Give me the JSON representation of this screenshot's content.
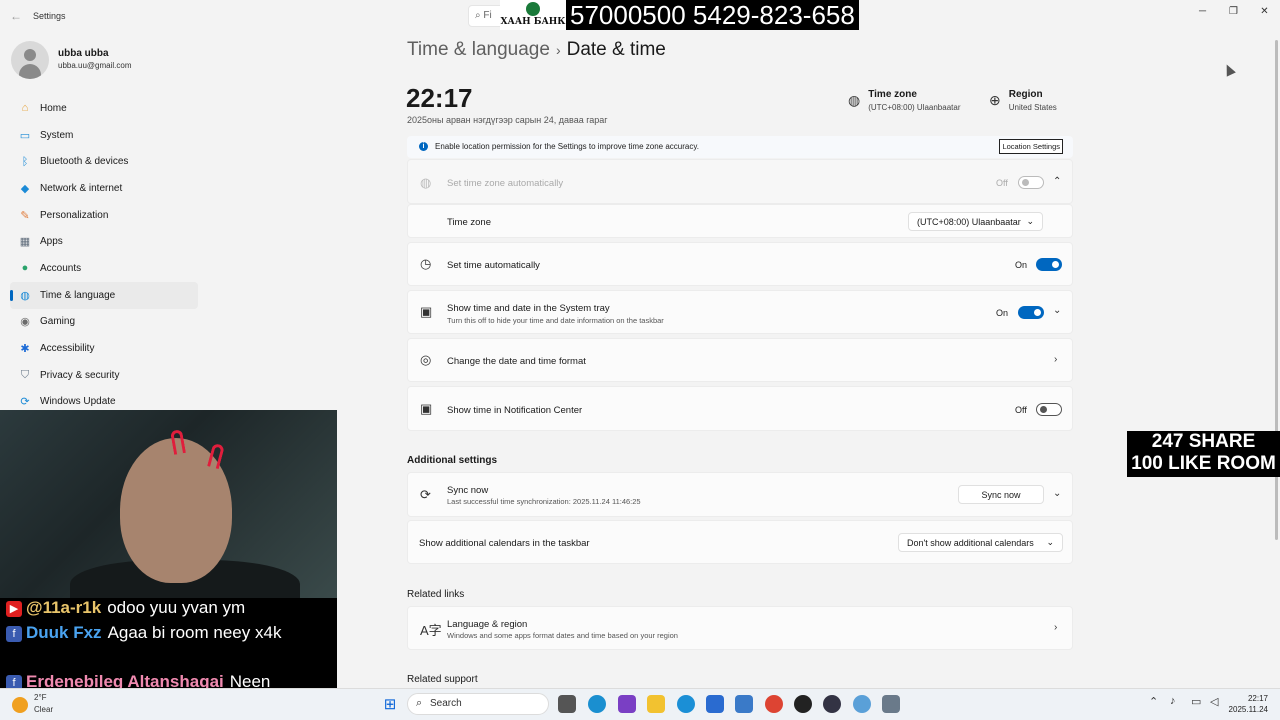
{
  "window": {
    "app_title": "Settings",
    "search_placeholder": "Fi"
  },
  "overlay": {
    "bank_name": "ХААН БАНК",
    "bank_number": "57000500 5429-823-658",
    "promo_line1": "247 SHARE",
    "promo_line2": "100 LIKE ROOM"
  },
  "profile": {
    "name": "ubba ubba",
    "email": "ubba.uu@gmail.com"
  },
  "sidebar": {
    "items": [
      {
        "label": "Home",
        "icon": "home-icon",
        "color": "#e5a33b"
      },
      {
        "label": "System",
        "icon": "monitor-icon",
        "color": "#1b8ad6"
      },
      {
        "label": "Bluetooth & devices",
        "icon": "bluetooth-icon",
        "color": "#1b8ad6"
      },
      {
        "label": "Network & internet",
        "icon": "wifi-icon",
        "color": "#1b8ad6"
      },
      {
        "label": "Personalization",
        "icon": "brush-icon",
        "color": "#e07b3a"
      },
      {
        "label": "Apps",
        "icon": "apps-icon",
        "color": "#5e6b7a"
      },
      {
        "label": "Accounts",
        "icon": "person-icon",
        "color": "#2aa36b"
      },
      {
        "label": "Time & language",
        "icon": "globe-clock-icon",
        "color": "#1b8ad6"
      },
      {
        "label": "Gaming",
        "icon": "controller-icon",
        "color": "#6b6b6b"
      },
      {
        "label": "Accessibility",
        "icon": "accessibility-icon",
        "color": "#1b6ad6"
      },
      {
        "label": "Privacy & security",
        "icon": "shield-icon",
        "color": "#6b7a8a"
      },
      {
        "label": "Windows Update",
        "icon": "update-icon",
        "color": "#1b8ad6"
      }
    ],
    "active_index": 7
  },
  "header": {
    "breadcrumb_parent": "Time & language",
    "breadcrumb_current": "Date & time",
    "time": "22:17",
    "date": "2025оны арван нэгдүгээр сарын 24, даваа гараг",
    "timezone_label": "Time zone",
    "timezone_value": "(UTC+08:00) Ulaanbaatar",
    "region_label": "Region",
    "region_value": "United States"
  },
  "banner": {
    "text": "Enable location permission for the Settings to improve time zone accuracy.",
    "button": "Location Settings"
  },
  "settings": {
    "auto_timezone": {
      "title": "Set time zone automatically",
      "state": "Off"
    },
    "timezone": {
      "title": "Time zone",
      "value": "(UTC+08:00) Ulaanbaatar"
    },
    "auto_time": {
      "title": "Set time automatically",
      "state": "On"
    },
    "tray": {
      "title": "Show time and date in the System tray",
      "subtitle": "Turn this off to hide your time and date information on the taskbar",
      "state": "On"
    },
    "format": {
      "title": "Change the date and time format"
    },
    "notification": {
      "title": "Show time in Notification Center",
      "state": "Off"
    }
  },
  "additional": {
    "section_title": "Additional settings",
    "sync_title": "Sync now",
    "sync_subtitle": "Last successful time synchronization: 2025.11.24 11:46:25",
    "sync_button": "Sync now",
    "calendars_title": "Show additional calendars in the taskbar",
    "calendars_value": "Don't show additional calendars"
  },
  "related": {
    "links_title": "Related links",
    "lang_title": "Language & region",
    "lang_subtitle": "Windows and some apps format dates and time based on your region",
    "support_title": "Related support"
  },
  "chat": {
    "lines": [
      {
        "source": "youtube",
        "user": "@11a-r1k",
        "user_color": "#e8c46a",
        "message": "odoo yuu yvan ym"
      },
      {
        "source": "facebook",
        "user": "Duuk Fxz",
        "user_color": "#4aa3f0",
        "message": "Agaa bi room neey x4k"
      },
      {
        "source": "facebook",
        "user": "Erdenebileg Altanshagai",
        "user_color": "#f08ab0",
        "message": "Neen"
      }
    ]
  },
  "taskbar": {
    "weather_temp": "2°F",
    "weather_cond": "Clear",
    "search_label": "Search",
    "clock_time": "22:17",
    "clock_date": "2025.11.24"
  }
}
